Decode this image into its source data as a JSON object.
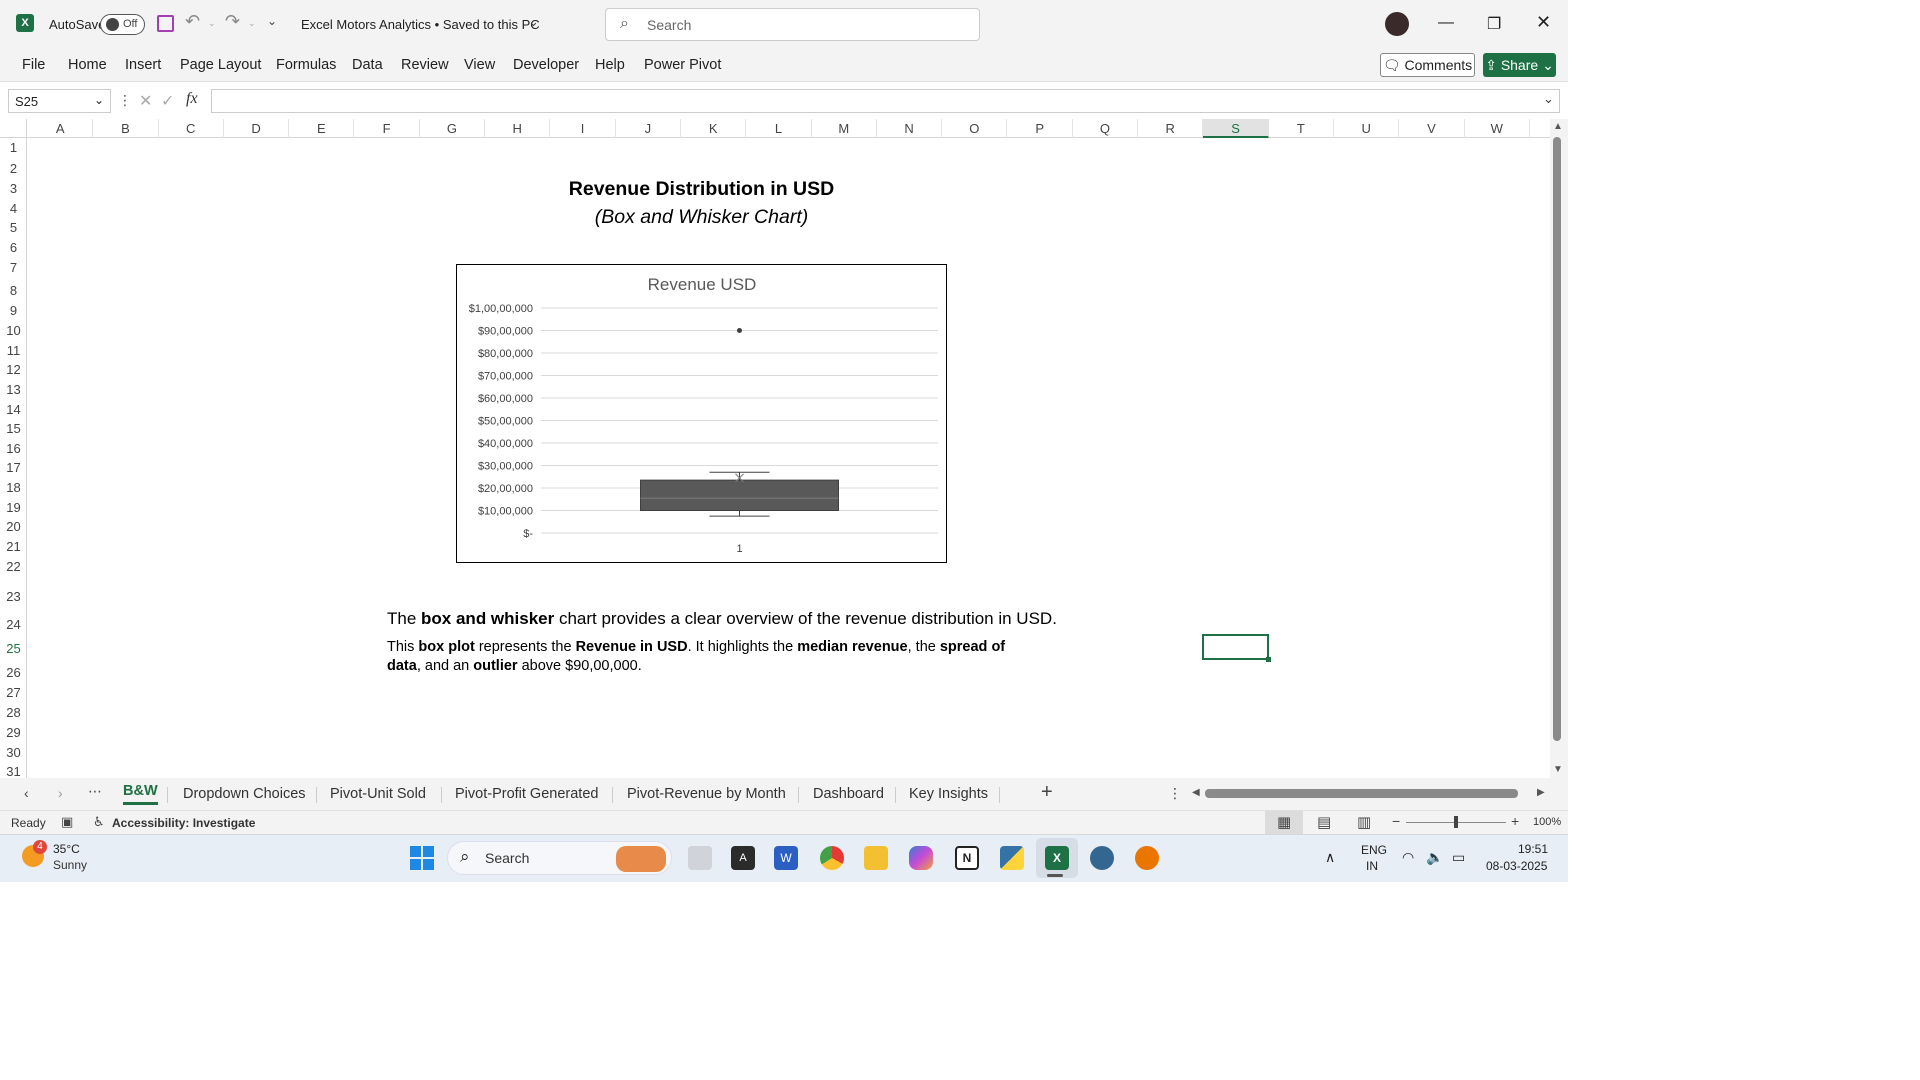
{
  "titlebar": {
    "autosave_label": "AutoSave",
    "autosave_state": "Off",
    "document_title": "Excel Motors Analytics • Saved to this PC",
    "search_placeholder": "Search"
  },
  "menu": [
    "File",
    "Home",
    "Insert",
    "Page Layout",
    "Formulas",
    "Data",
    "Review",
    "View",
    "Developer",
    "Help",
    "Power Pivot"
  ],
  "actions": {
    "comments_label": "Comments",
    "share_label": "Share"
  },
  "formula_bar": {
    "name_box": "S25",
    "fx_label": "fx",
    "value": ""
  },
  "columns": [
    "A",
    "B",
    "C",
    "D",
    "E",
    "F",
    "G",
    "H",
    "I",
    "J",
    "K",
    "L",
    "M",
    "N",
    "O",
    "P",
    "Q",
    "R",
    "S",
    "T",
    "U",
    "V",
    "W"
  ],
  "selected_column": "S",
  "rows": [
    "1",
    "2",
    "3",
    "4",
    "5",
    "6",
    "7",
    "8",
    "9",
    "10",
    "11",
    "12",
    "13",
    "14",
    "15",
    "16",
    "17",
    "18",
    "19",
    "20",
    "21",
    "22",
    "23",
    "24",
    "25",
    "26",
    "27",
    "28",
    "29",
    "30",
    "31"
  ],
  "selected_row": "25",
  "sheet": {
    "heading": "Revenue Distribution in USD",
    "subheading": "(Box and Whisker Chart)",
    "desc1": [
      {
        "t": "The ",
        "b": false
      },
      {
        "t": "box and whisker",
        "b": true
      },
      {
        "t": " chart provides a clear overview of the revenue distribution in USD.",
        "b": false
      }
    ],
    "desc2_line1": [
      {
        "t": "This ",
        "b": false
      },
      {
        "t": "box plot",
        "b": true
      },
      {
        "t": " represents the ",
        "b": false
      },
      {
        "t": "Revenue in USD",
        "b": true
      },
      {
        "t": ". It highlights the ",
        "b": false
      },
      {
        "t": "median revenue",
        "b": true
      },
      {
        "t": ", the ",
        "b": false
      },
      {
        "t": "spread of",
        "b": true
      }
    ],
    "desc2_line2": [
      {
        "t": "data",
        "b": true
      },
      {
        "t": ", and an ",
        "b": false
      },
      {
        "t": "outlier",
        "b": true
      },
      {
        "t": " above $90,00,000.",
        "b": false
      }
    ]
  },
  "chart_data": {
    "type": "box",
    "title": "Revenue USD",
    "categories": [
      "1"
    ],
    "ylim": [
      0,
      10000000
    ],
    "y_tick_labels": [
      "$-",
      "$10,00,000",
      "$20,00,000",
      "$30,00,000",
      "$40,00,000",
      "$50,00,000",
      "$60,00,000",
      "$70,00,000",
      "$80,00,000",
      "$90,00,000",
      "$1,00,00,000"
    ],
    "y_ticks": [
      0,
      1000000,
      2000000,
      3000000,
      4000000,
      5000000,
      6000000,
      7000000,
      8000000,
      9000000,
      10000000
    ],
    "box": {
      "whisker_low": 750000,
      "q1": 1000000,
      "median": 1550000,
      "q3": 2350000,
      "whisker_high": 2700000,
      "mean": 2450000
    },
    "outliers": [
      9000000
    ],
    "box_color": "#595959",
    "grid": true
  },
  "sheet_tabs": [
    "B&W",
    "Dropdown Choices",
    "Pivot-Unit Sold",
    "Pivot-Profit Generated",
    "Pivot-Revenue by Month",
    "Dashboard",
    "Key Insights"
  ],
  "active_tab": "B&W",
  "status": {
    "ready": "Ready",
    "accessibility": "Accessibility: Investigate",
    "zoom": "100%"
  },
  "taskbar": {
    "weather_temp": "35°C",
    "weather_desc": "Sunny",
    "weather_badge": "4",
    "search_label": "Search",
    "lang1": "ENG",
    "lang2": "IN",
    "time": "19:51",
    "date": "08-03-2025"
  },
  "colors": {
    "excel_green": "#1e7145",
    "accent": "#1e7145"
  }
}
